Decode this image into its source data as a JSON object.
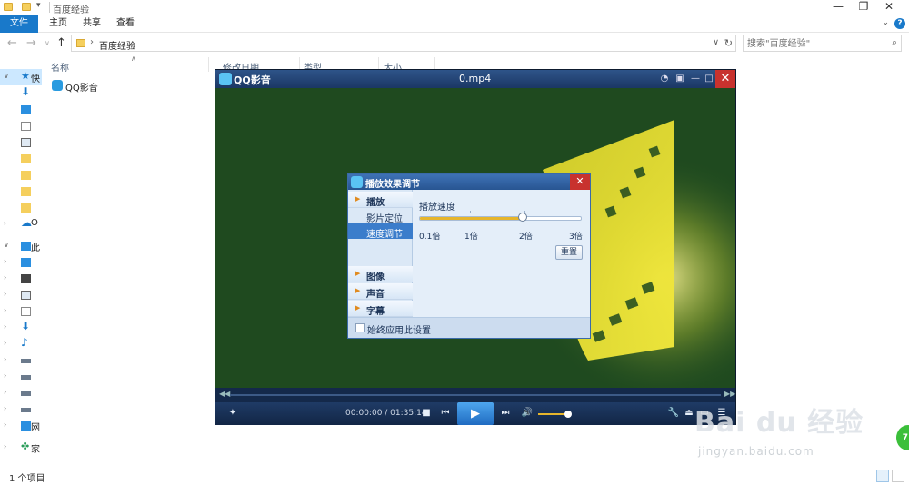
{
  "explorer": {
    "title": "百度经验",
    "ribbon_tabs": [
      "文件",
      "主页",
      "共享",
      "查看"
    ],
    "address": "百度经验",
    "search_placeholder": "搜索\"百度经验\"",
    "columns": [
      "名称",
      "修改日期",
      "类型",
      "大小"
    ],
    "files": [
      {
        "name": "QQ影音"
      }
    ],
    "nav_items": [
      {
        "label": "快"
      },
      {
        "label": ""
      },
      {
        "label": ""
      },
      {
        "label": ""
      },
      {
        "label": ""
      },
      {
        "label": ""
      },
      {
        "label": ""
      },
      {
        "label": ""
      },
      {
        "label": ""
      },
      {
        "label": "O"
      },
      {
        "label": "此"
      },
      {
        "label": ""
      },
      {
        "label": ""
      },
      {
        "label": ""
      },
      {
        "label": ""
      },
      {
        "label": ""
      },
      {
        "label": ""
      },
      {
        "label": ""
      },
      {
        "label": ""
      },
      {
        "label": ""
      },
      {
        "label": ""
      },
      {
        "label": "网"
      },
      {
        "label": "家"
      }
    ],
    "status": "1 个项目"
  },
  "player": {
    "app_name": "QQ影音",
    "file_name": "0.mp4",
    "time": "00:00:00 / 01:35:14",
    "volume_level": 0.85
  },
  "dialog": {
    "title": "播放效果调节",
    "categories": {
      "play": "播放",
      "image": "图像",
      "sound": "声音",
      "subtitle": "字幕"
    },
    "sub_items": {
      "position": "影片定位",
      "speed": "速度调节"
    },
    "speed_label": "播放速度",
    "speed_ticks": [
      "0.1倍",
      "1倍",
      "2倍",
      "3倍"
    ],
    "speed_value_fraction": 0.64,
    "reset": "重置",
    "always_apply": "始终应用此设置"
  },
  "watermark": {
    "main": "Bai du 经验",
    "sub": "jingyan.baidu.com",
    "badge": "71"
  },
  "colors": {
    "accent": "#1979ca",
    "player_dark": "#1a2e4f",
    "close_red": "#c8322e",
    "slider_gold": "#e6b52c"
  }
}
